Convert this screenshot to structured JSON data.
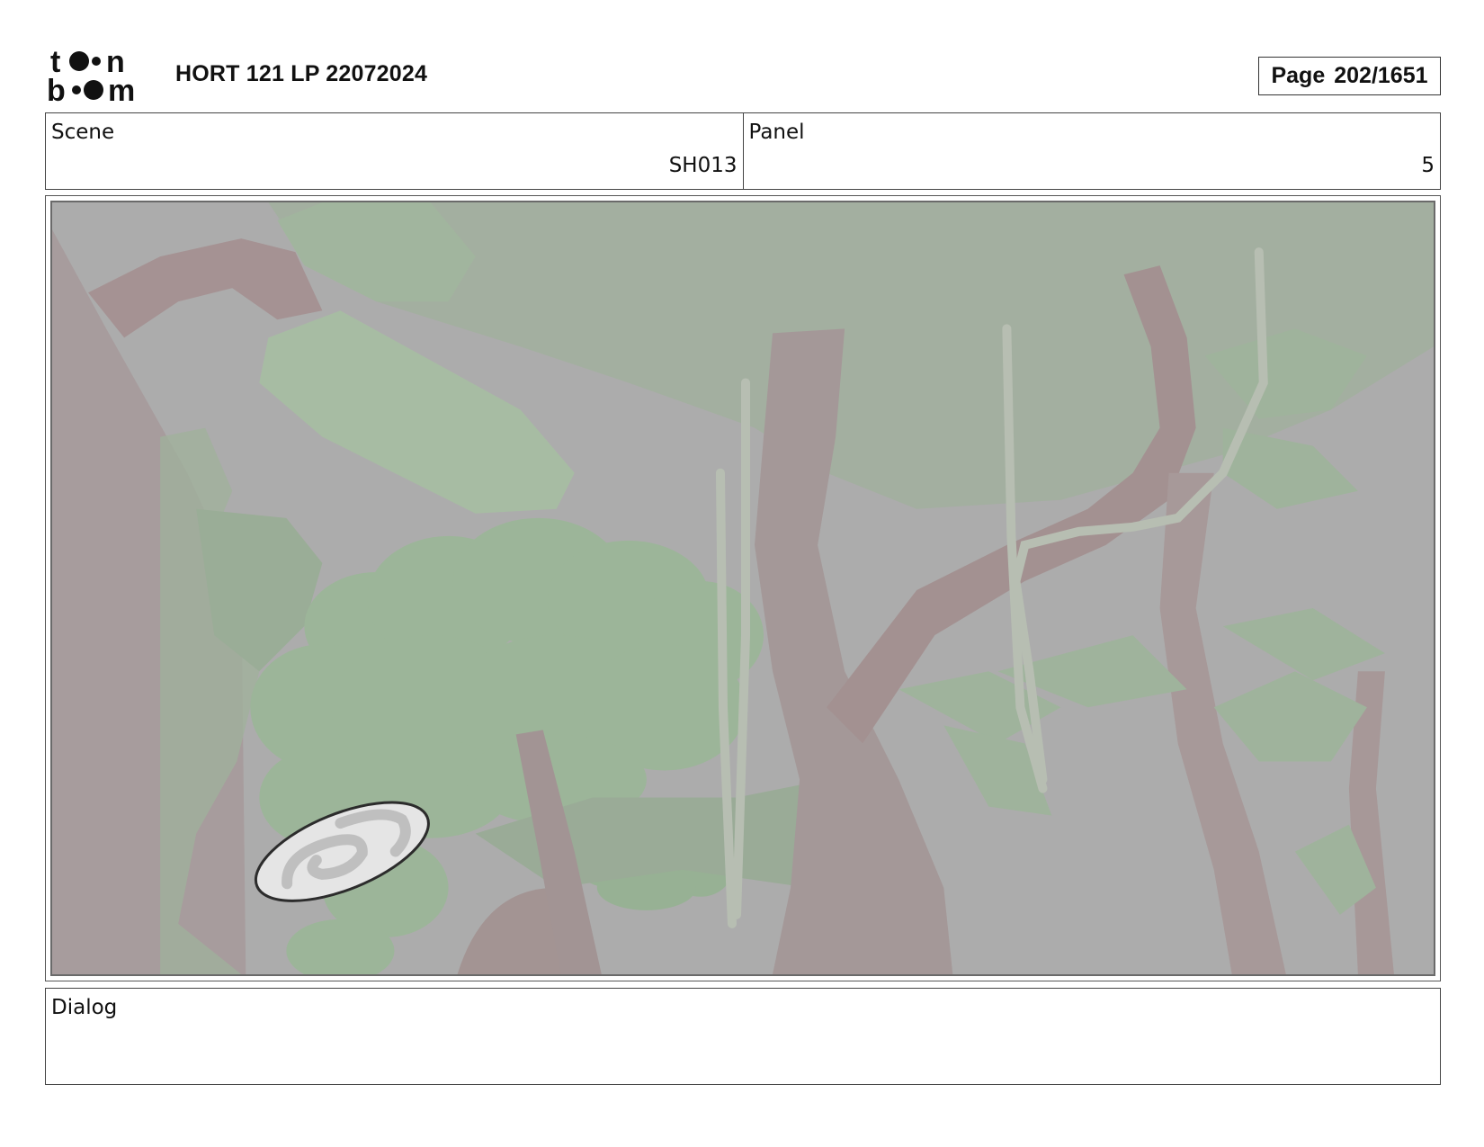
{
  "header": {
    "logo_text": "toon boom",
    "title": "HORT 121 LP 22072024",
    "page_label": "Page",
    "page_number": "202/1651"
  },
  "scene": {
    "label": "Scene",
    "value": "SH013"
  },
  "panel": {
    "label": "Panel",
    "value": "5"
  },
  "dialog": {
    "label": "Dialog",
    "text": ""
  },
  "colors": {
    "background_gray": "#adadad",
    "foliage_green": "#9bb598",
    "trunk_brown": "#a59592",
    "vine_pale": "#bcc6b5"
  }
}
